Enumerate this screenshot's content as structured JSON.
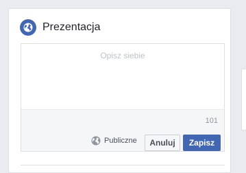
{
  "section": {
    "title": "Prezentacja",
    "icon": "globe-icon"
  },
  "editor": {
    "placeholder": "Opisz siebie",
    "value": "",
    "char_counter": "101"
  },
  "privacy": {
    "icon": "globe-icon",
    "label": "Publiczne"
  },
  "actions": {
    "cancel_label": "Anuluj",
    "save_label": "Zapisz"
  },
  "colors": {
    "accent": "#4267b2",
    "header_icon_bg": "#4267b2",
    "page_bg": "#e9ebee"
  }
}
